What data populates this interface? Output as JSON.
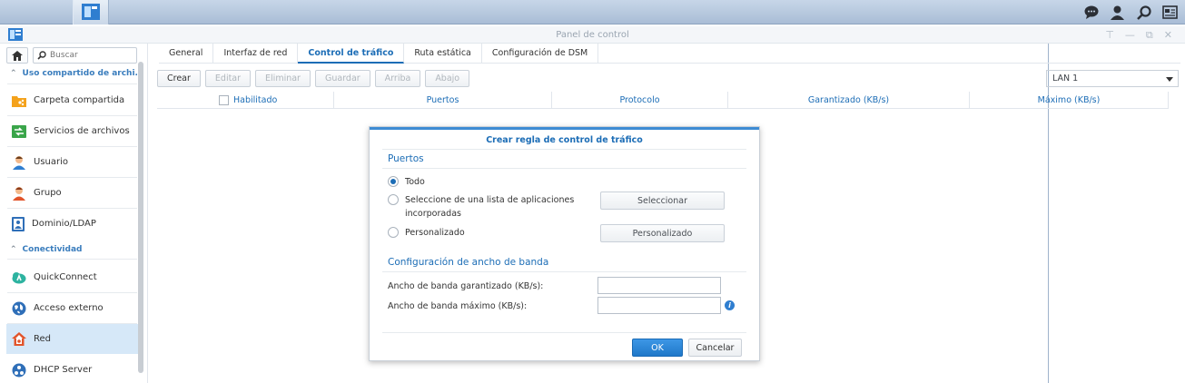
{
  "window": {
    "title": "Panel de control"
  },
  "sidebar": {
    "search_placeholder": "Buscar",
    "sections": [
      {
        "label": "Uso compartido de archi..."
      },
      {
        "label": "Conectividad"
      }
    ],
    "items": [
      {
        "label": "Carpeta compartida"
      },
      {
        "label": "Servicios de archivos"
      },
      {
        "label": "Usuario"
      },
      {
        "label": "Grupo"
      },
      {
        "label": "Dominio/LDAP"
      },
      {
        "label": "QuickConnect"
      },
      {
        "label": "Acceso externo"
      },
      {
        "label": "Red"
      },
      {
        "label": "DHCP Server"
      }
    ]
  },
  "tabs": [
    "General",
    "Interfaz de red",
    "Control de tráfico",
    "Ruta estática",
    "Configuración de DSM"
  ],
  "toolbar": [
    "Crear",
    "Editar",
    "Eliminar",
    "Guardar",
    "Arriba",
    "Abajo"
  ],
  "interface_select": "LAN 1",
  "grid_columns": [
    "Habilitado",
    "Puertos",
    "Protocolo",
    "Garantizado (KB/s)",
    "Máximo (KB/s)"
  ],
  "dialog": {
    "title": "Crear regla de control de tráfico",
    "ports_section": "Puertos",
    "radio_all": "Todo",
    "radio_apps": "Seleccione de una lista de aplicaciones incorporadas",
    "radio_custom": "Personalizado",
    "select_button": "Seleccionar",
    "custom_button": "Personalizado",
    "bandwidth_section": "Configuración de ancho de banda",
    "guaranteed_label": "Ancho de banda garantizado (KB/s):",
    "max_label": "Ancho de banda máximo (KB/s):",
    "guaranteed_value": "",
    "max_value": "",
    "ok": "OK",
    "cancel": "Cancelar"
  },
  "colors": {
    "accent": "#1c6db6",
    "selection": "#d6e8f8"
  }
}
